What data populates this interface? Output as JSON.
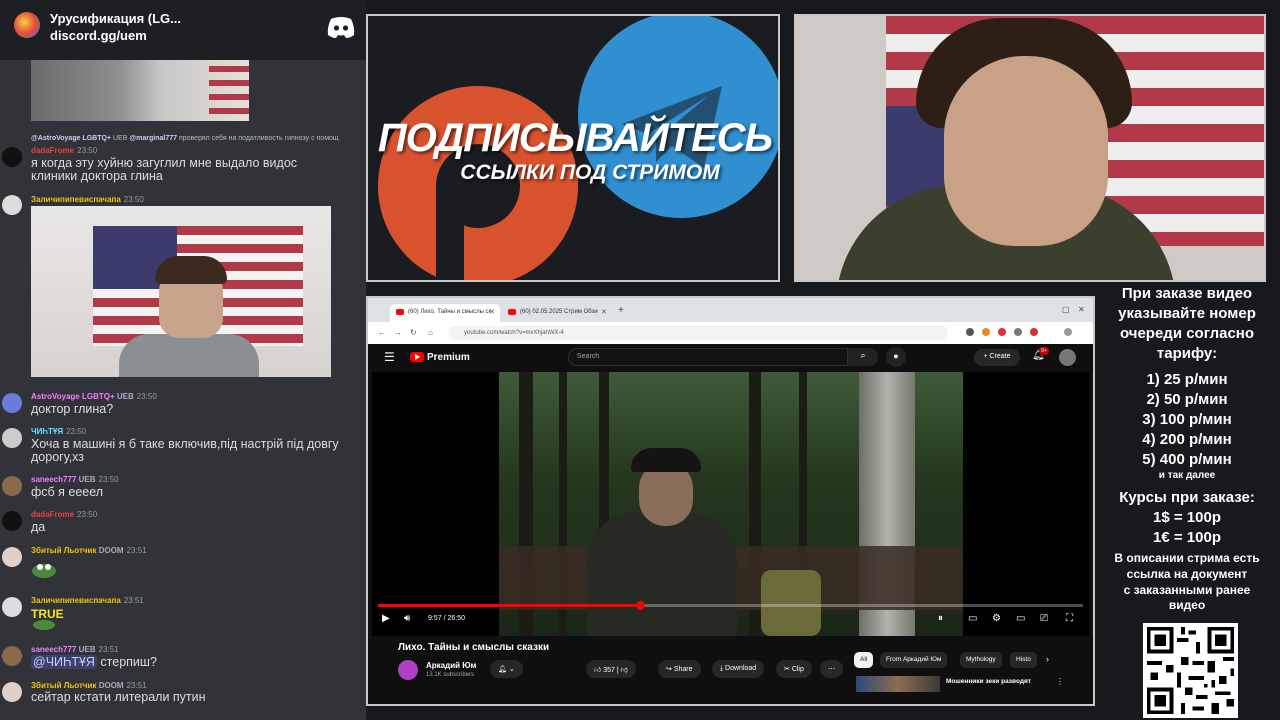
{
  "discord": {
    "server_name": "Урусификация (LG...",
    "invite_link": "discord.gg/uem"
  },
  "chat": {
    "reply1": {
      "reply_user": "@AstroVoyage LGBTQ+",
      "reply_badge": "UEB",
      "reply_mention": "@marginal777",
      "reply_text": "проверял себя на податливость гипнозу с помощ",
      "user": "dadaFrome",
      "time": "23:50",
      "text_line1": "я когда эту хуйню загуглил мне выдало видос",
      "text_line2": "клиники доктора глина"
    },
    "msg2": {
      "user": "Заличипипевиспачапа",
      "time": "23:50"
    },
    "msg3": {
      "user": "AstroVoyage LGBTQ+",
      "badge": "UEB",
      "time": "23:50",
      "text": "доктор глина?"
    },
    "msg4": {
      "user": "ЧИҺТҰЯ",
      "time": "23:50",
      "text_line1": "Хоча в машині я б таке включив,під настрій під довгу",
      "text_line2": "дорогу,хз"
    },
    "msg5": {
      "user": "saneech777",
      "badge": "UEB",
      "time": "23:50",
      "text": "фсб я еееел"
    },
    "msg6": {
      "user": "dadaFrome",
      "time": "23:50",
      "text": "да"
    },
    "msg7": {
      "user": "Збитый Льотчик",
      "badge": "DOOM",
      "time": "23:51"
    },
    "msg8": {
      "user": "Заличипипевиспачапа",
      "time": "23:51",
      "emoji_text": "TRUE"
    },
    "msg9": {
      "user": "saneech777",
      "badge": "UEB",
      "time": "23:51",
      "mention": "@ЧИҺТҰЯ",
      "text": " стерпиш?"
    },
    "msg10": {
      "user": "Збитый Льотчик",
      "badge": "DOOM",
      "time": "23:51",
      "text": "сейтар кстати литерали путин"
    }
  },
  "banner": {
    "line1": "ПОДПИСЫВАЙТЕСЬ",
    "line2": "ССЫЛКИ ПОД СТРИМОМ"
  },
  "browser": {
    "tab1": "(60) Лихо. Тайны и смыслы ск",
    "tab2": "(60) 02.05.2025 Стрим Обзи",
    "url": "youtube.com/watch?v=mvXhjahWX-4"
  },
  "youtube": {
    "brand": "Premium",
    "search_placeholder": "Search",
    "create_label": "Create",
    "notif_count": "9+",
    "time_display": "9:57 / 26:50",
    "progress_fraction": 0.371,
    "video_title": "Лихо. Тайны и смыслы сказки",
    "channel_name": "Аркадий Юм",
    "subscribers": "13.1K subscribers",
    "likes": "357",
    "share_label": "Share",
    "download_label": "Download",
    "clip_label": "Clip",
    "chips": [
      "All",
      "From Аркадий Юм",
      "Mythology",
      "Histo"
    ],
    "rec_title": "Мошенники зеки разводят"
  },
  "info": {
    "l1": "При заказе видео",
    "l2": "указывайте номер",
    "l3": "очереди согласно",
    "l4": "тарифу:",
    "p1": "1) 25 р/мин",
    "p2": "2) 50 р/мин",
    "p3": "3) 100 р/мин",
    "p4": "4) 200 р/мин",
    "p5": "5) 400 р/мин",
    "etc": "и так далее",
    "rates_title": "Курсы при заказе:",
    "rate1": "1$ = 100р",
    "rate2": "1€ = 100р",
    "d1": "В описании стрима есть",
    "d2": "ссылка на документ",
    "d3": "с заказанными ранее",
    "d4": "видео"
  },
  "colors": {
    "discord_bg": "#313338",
    "yt_red": "#ff0000",
    "telegram_blue": "#2f8fd1",
    "patreon_orange": "#d9522e"
  }
}
